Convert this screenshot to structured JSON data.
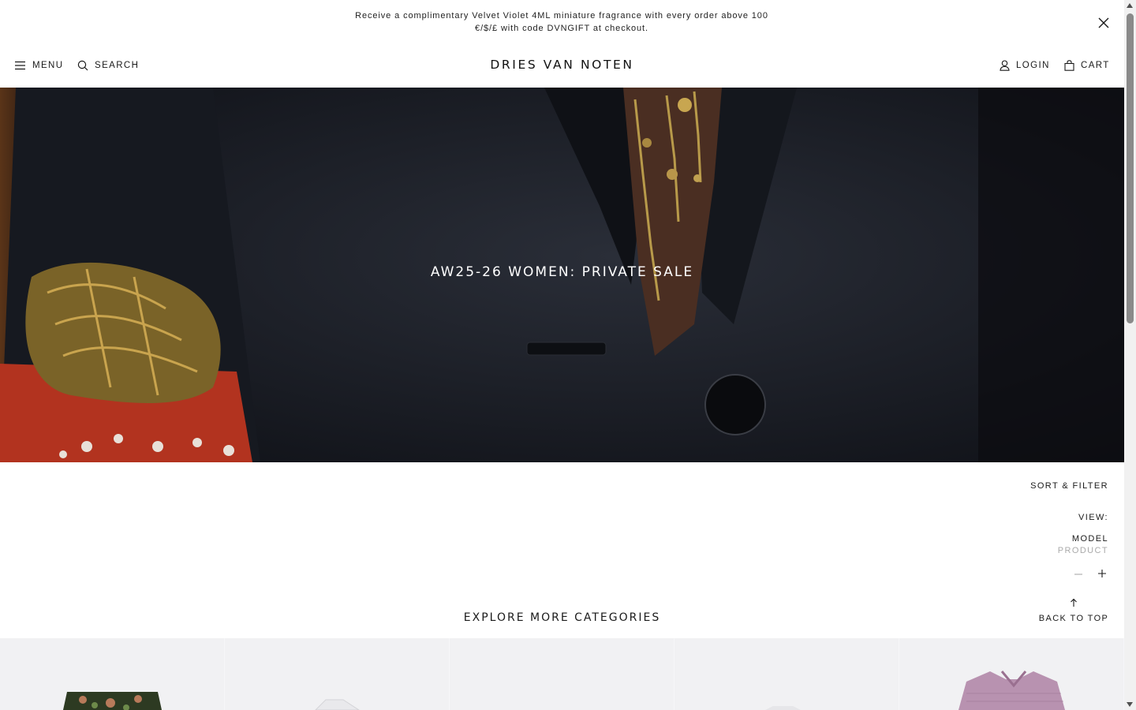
{
  "announcement": {
    "line1": "Receive a complimentary Velvet Violet 4ML miniature fragrance with every order above 100",
    "line2": "€/$/£ with code DVNGIFT at checkout."
  },
  "header": {
    "menu_label": "MENU",
    "search_label": "SEARCH",
    "logo": "DRIES VAN NOTEN",
    "login_label": "LOGIN",
    "cart_label": "CART"
  },
  "hero": {
    "title": "AW25-26 WOMEN: PRIVATE SALE"
  },
  "controls": {
    "sort_filter": "SORT & FILTER",
    "view_label": "VIEW:",
    "view_model": "MODEL",
    "view_product": "PRODUCT",
    "back_to_top": "BACK TO TOP"
  },
  "explore": {
    "title": "EXPLORE MORE CATEGORIES"
  },
  "icons": {
    "close": "close-icon",
    "menu": "hamburger-icon",
    "search": "search-icon",
    "user": "user-icon",
    "cart": "bag-icon",
    "minus": "minus-icon",
    "plus": "plus-icon",
    "arrow_up": "arrow-up-icon"
  },
  "colors": {
    "text": "#1a1a1a",
    "muted": "#aaaaaa",
    "hero_bg": "#1b1e25",
    "category_bg": "#f1f1f3"
  }
}
